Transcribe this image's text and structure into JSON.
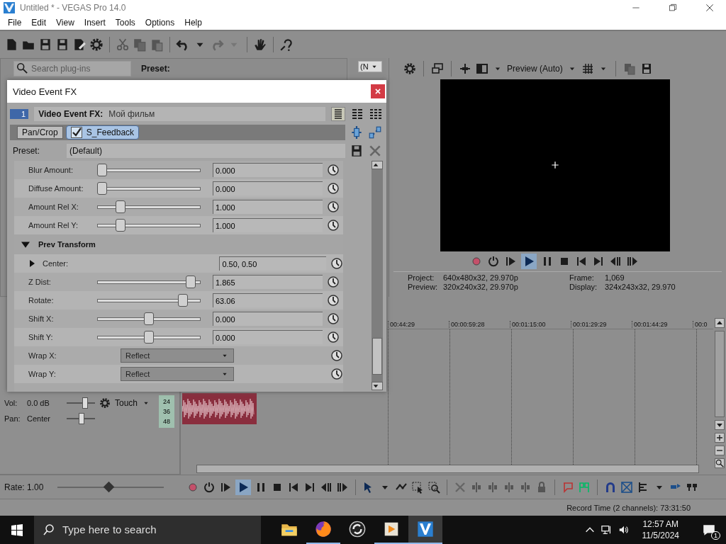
{
  "window": {
    "title": "Untitled * - VEGAS Pro 14.0"
  },
  "menu": [
    "File",
    "Edit",
    "View",
    "Insert",
    "Tools",
    "Options",
    "Help"
  ],
  "plugin_panel": {
    "search_placeholder": "Search plug-ins",
    "preset_label": "Preset:"
  },
  "side_dropdown": {
    "value": "(N"
  },
  "preview": {
    "mode": "Preview (Auto)",
    "playing": true,
    "info": [
      {
        "label": "Project:",
        "value": "640x480x32, 29.970p"
      },
      {
        "label": "Frame:",
        "value": "1,069"
      },
      {
        "label": "Preview:",
        "value": "320x240x32, 29.970p"
      },
      {
        "label": "Display:",
        "value": "324x243x32, 29.970"
      }
    ]
  },
  "dialog": {
    "title": "Video Event FX",
    "badge": "1",
    "header_label": "Video Event FX:",
    "header_value": "Мой фильм",
    "chain": [
      {
        "kind": "builtin",
        "label": "Pan/Crop",
        "selected": false
      },
      {
        "kind": "plugin",
        "label": "S_Feedback",
        "selected": true,
        "checked": true
      }
    ],
    "preset_label": "Preset:",
    "preset": "(Default)",
    "params": [
      {
        "kind": "slider",
        "label": "Blur Amount:",
        "level": 0,
        "value": "0.000"
      },
      {
        "kind": "slider",
        "label": "Diffuse Amount:",
        "level": 0,
        "value": "0.000"
      },
      {
        "kind": "slider",
        "label": "Amount Rel X:",
        "level": 0.2,
        "value": "1.000"
      },
      {
        "kind": "slider",
        "label": "Amount Rel Y:",
        "level": 0.2,
        "value": "1.000"
      },
      {
        "kind": "section",
        "label": "Prev Transform",
        "expanded": true
      },
      {
        "kind": "point",
        "label": "Center:",
        "value": "0.50, 0.50",
        "expanded": false
      },
      {
        "kind": "slider",
        "label": "Z Dist:",
        "level": 0.95,
        "value": "1.865"
      },
      {
        "kind": "slider",
        "label": "Rotate:",
        "level": 0.86,
        "value": "63.06"
      },
      {
        "kind": "slider",
        "label": "Shift X:",
        "level": 0.5,
        "value": "0.000"
      },
      {
        "kind": "slider",
        "label": "Shift Y:",
        "level": 0.5,
        "value": "0.000"
      },
      {
        "kind": "choice",
        "label": "Wrap X:",
        "value": "Reflect"
      },
      {
        "kind": "choice",
        "label": "Wrap Y:",
        "value": "Reflect"
      }
    ]
  },
  "track": {
    "vol_label": "Vol:",
    "vol": "0.0 dB",
    "vol_slider": {
      "level": 0.65
    },
    "pan_label": "Pan:",
    "pan": "Center",
    "pan_slider": {
      "level": 0.5
    },
    "automation": "Touch",
    "meter": [
      "24",
      "36",
      "48"
    ]
  },
  "ruler": [
    "00:44:29",
    "00:00:59:28",
    "00:01:15:00",
    "00:01:29:29",
    "00:01:44:29",
    "00:0"
  ],
  "rate": "Rate: 1.00",
  "rate_slider": {
    "level": 0.5
  },
  "status_bar": {
    "record_time": "Record Time (2 channels): 73:31:50"
  },
  "taskbar": {
    "search_placeholder": "Type here to search",
    "time": "12:57 AM",
    "date": "11/5/2024",
    "notifications": "1",
    "apps": [
      {
        "kind": "folder",
        "running": false,
        "active": false
      },
      {
        "kind": "browser",
        "running": true,
        "active": false
      },
      {
        "kind": "sync",
        "running": false,
        "active": false
      },
      {
        "kind": "player",
        "running": true,
        "active": false
      },
      {
        "kind": "editor",
        "running": true,
        "active": true
      }
    ]
  }
}
